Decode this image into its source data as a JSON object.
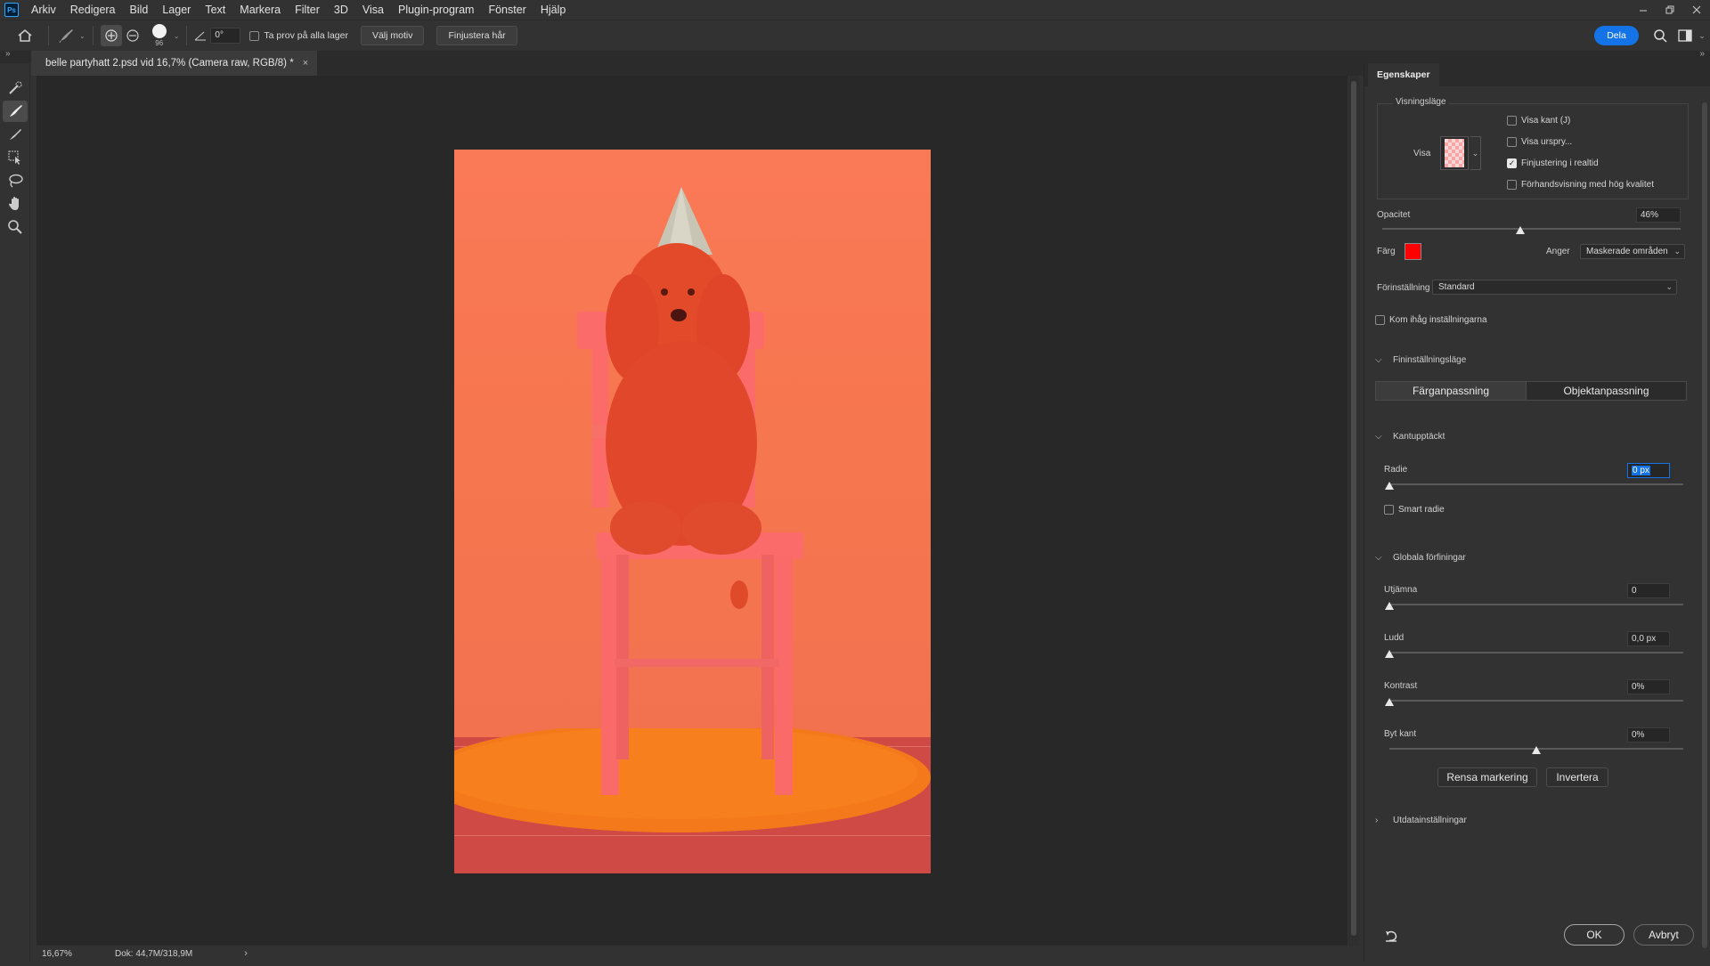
{
  "app": {
    "logo": "Ps",
    "menu": [
      "Arkiv",
      "Redigera",
      "Bild",
      "Lager",
      "Text",
      "Markera",
      "Filter",
      "3D",
      "Visa",
      "Plugin-program",
      "Fönster",
      "Hjälp"
    ]
  },
  "options_bar": {
    "brush_size": "96",
    "angle": "0°",
    "sample_all_layers_label": "Ta prov på alla lager",
    "select_subject_label": "Välj motiv",
    "refine_hair_label": "Finjustera hår",
    "share_label": "Dela"
  },
  "document": {
    "tab_title": "belle partyhatt 2.psd vid 16,7% (Camera raw, RGB/8) *",
    "tab_close": "×"
  },
  "status": {
    "zoom": "16,67%",
    "doc_size": "Dok: 44,7M/318,9M",
    "arrow": "›"
  },
  "properties": {
    "tab": "Egenskaper",
    "view_mode": {
      "group_title": "Visningsläge",
      "view_label": "Visa",
      "show_edge": {
        "label": "Visa kant (J)",
        "checked": false
      },
      "show_original": {
        "label": "Visa ursprу...",
        "checked": false
      },
      "realtime_refine": {
        "label": "Finjustering i realtid",
        "checked": true
      },
      "hq_preview": {
        "label": "Förhandsvisning med hög kvalitet",
        "checked": false
      }
    },
    "opacity": {
      "label": "Opacitet",
      "value": "46%",
      "fraction": 0.46
    },
    "color": {
      "label": "Färg",
      "swatch": "#ff0000"
    },
    "indicates": {
      "label": "Anger",
      "value": "Maskerade områden"
    },
    "preset": {
      "label": "Förinställning",
      "value": "Standard"
    },
    "remember": {
      "label": "Kom ihåg inställningarna",
      "checked": false
    },
    "refine_mode": {
      "title": "Fininställningsläge",
      "options": [
        "Färganpassning",
        "Objektanpassning"
      ],
      "selected": "Färganpassning"
    },
    "edge_detection": {
      "title": "Kantupptäckt",
      "radius_label": "Radie",
      "radius_value": "0 px",
      "radius_fraction": 0.0,
      "smart_radius": {
        "label": "Smart radie",
        "checked": false
      }
    },
    "global_refinements": {
      "title": "Globala förfiningar",
      "smooth": {
        "label": "Utjämna",
        "value": "0",
        "fraction": 0.0
      },
      "feather": {
        "label": "Ludd",
        "value": "0,0 px",
        "fraction": 0.0
      },
      "contrast": {
        "label": "Kontrast",
        "value": "0%",
        "fraction": 0.0
      },
      "shift_edge": {
        "label": "Byt kant",
        "value": "0%",
        "fraction": 0.5
      }
    },
    "clear_selection_label": "Rensa markering",
    "invert_label": "Invertera",
    "output_settings_title": "Utdatainställningar",
    "ok_label": "OK",
    "cancel_label": "Avbryt"
  },
  "colors": {
    "accent": "#1473e6",
    "overlay": "#ff0000"
  }
}
